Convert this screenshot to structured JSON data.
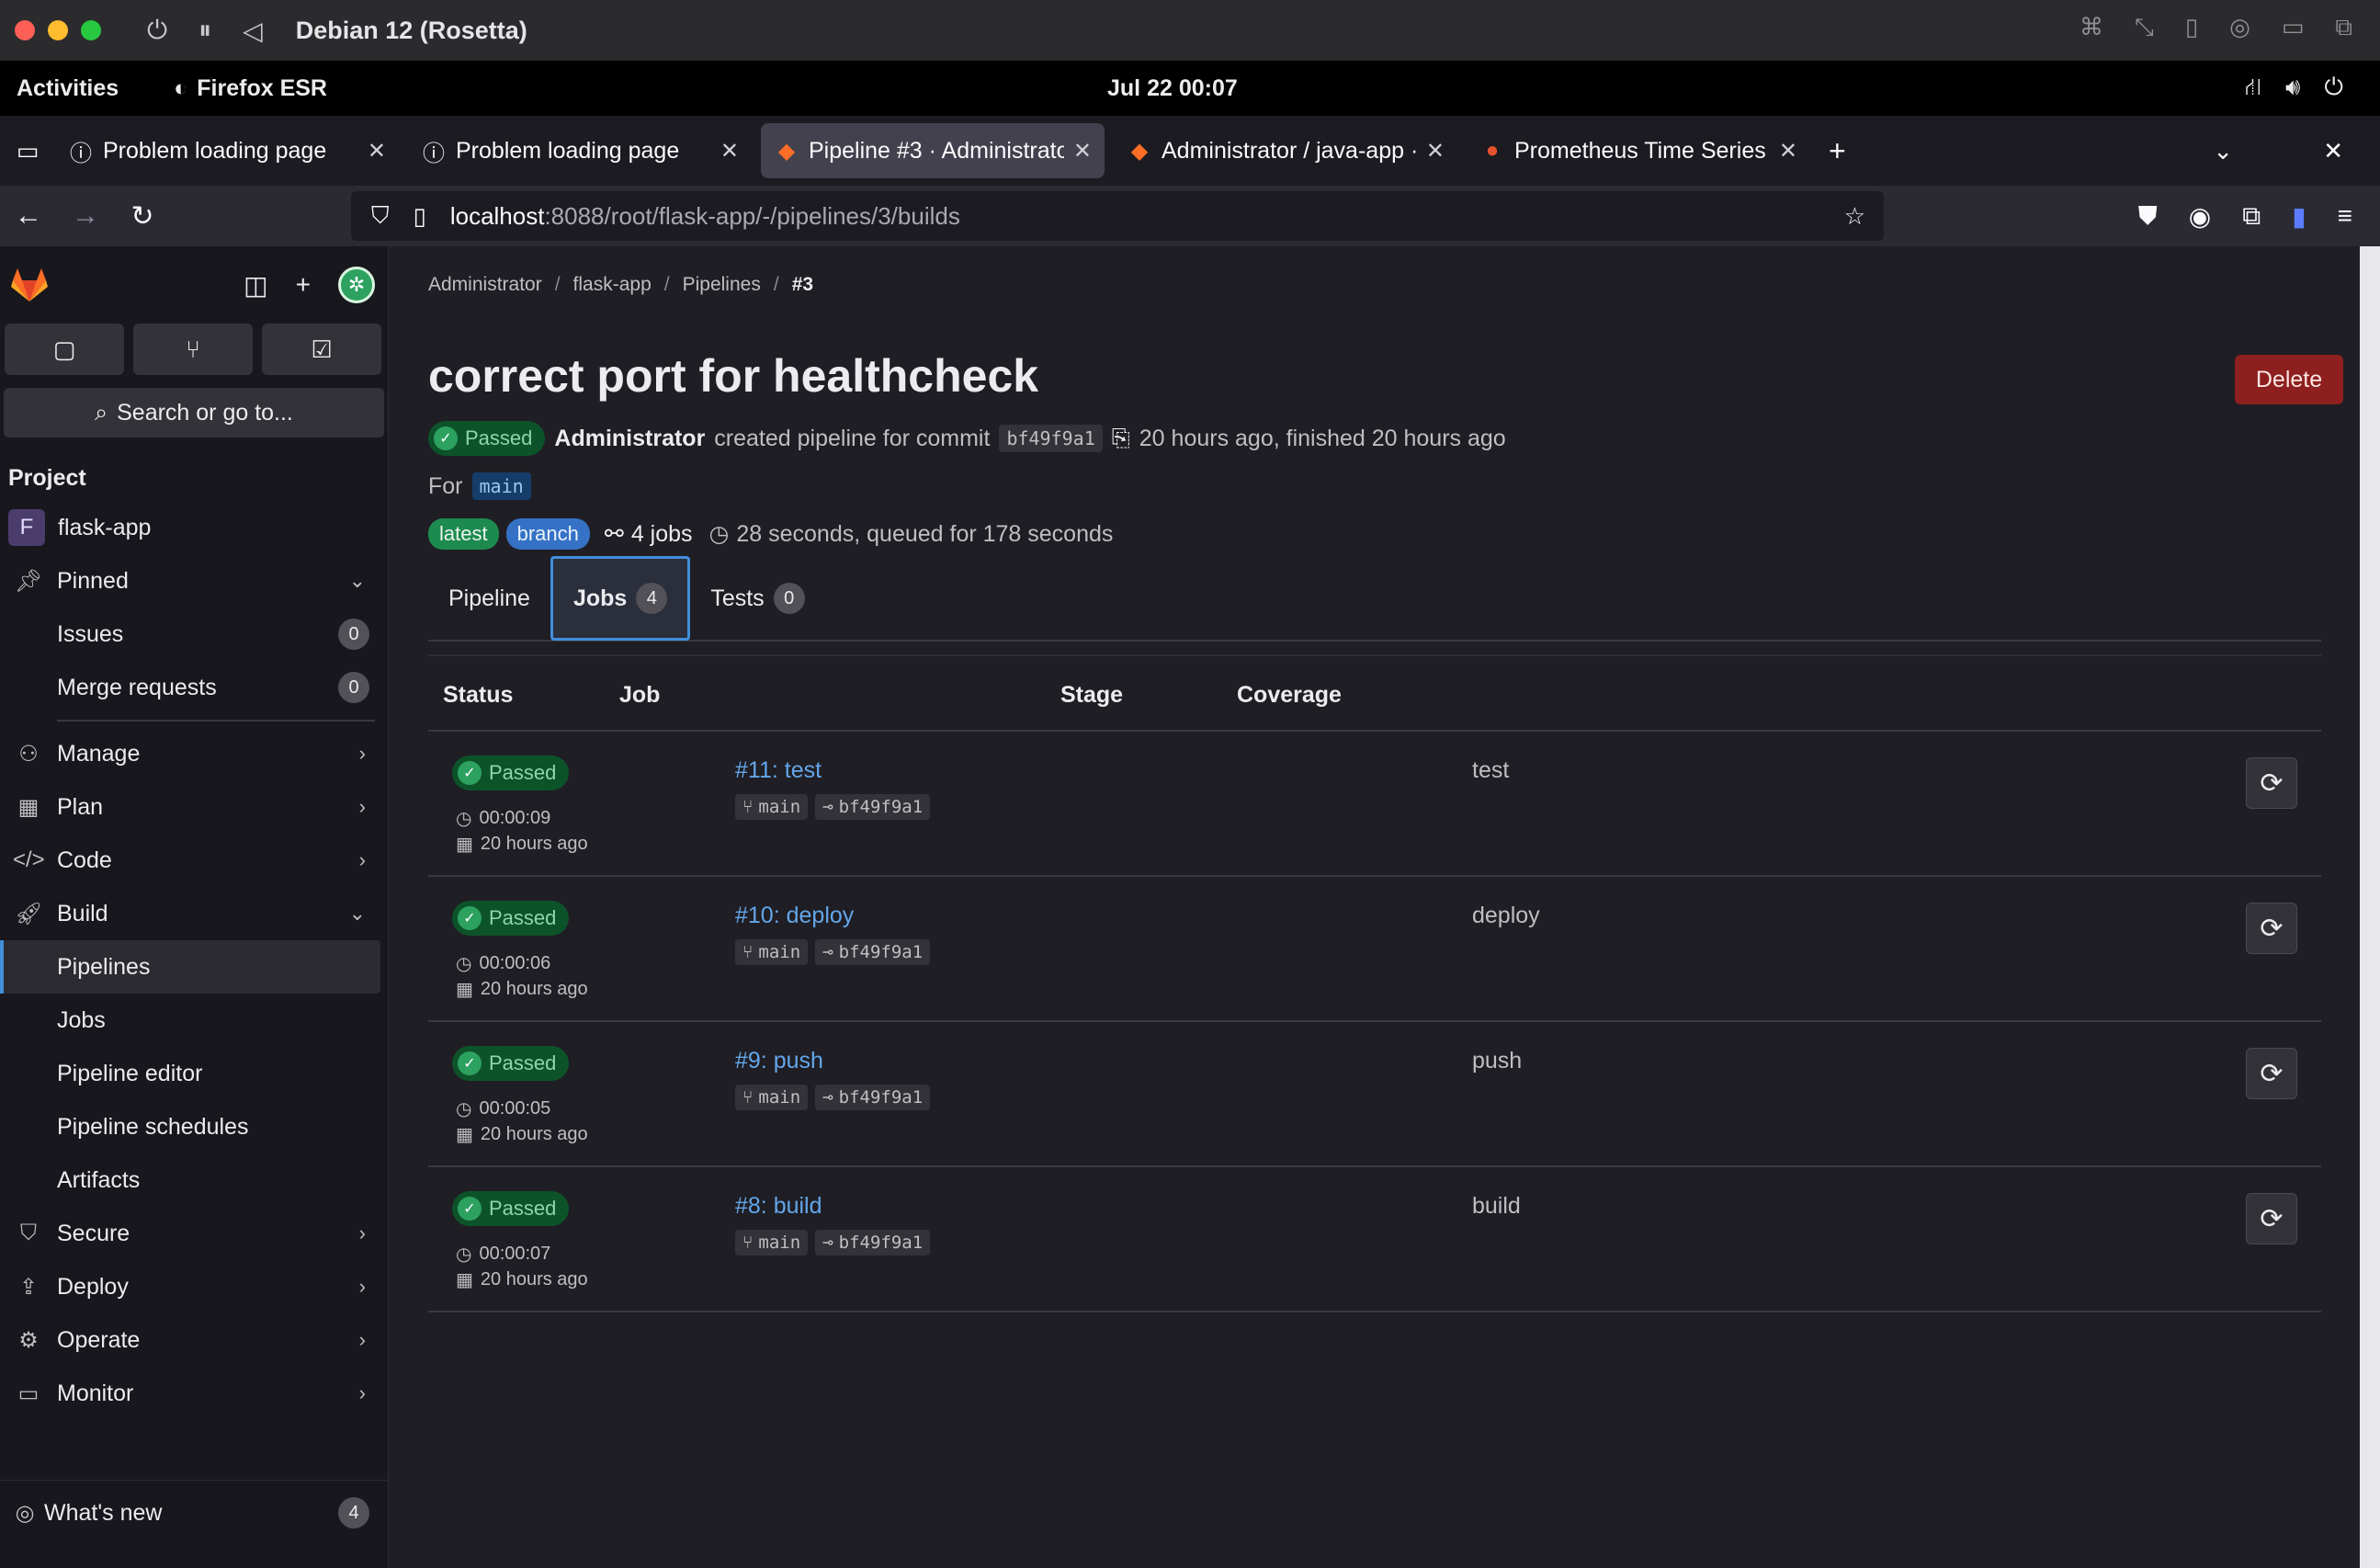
{
  "window": {
    "title": "Debian 12 (Rosetta)",
    "traffic_colors": [
      "#fe5f57",
      "#febc2e",
      "#28c840"
    ]
  },
  "gnome": {
    "activities": "Activities",
    "app": "Firefox ESR",
    "clock": "Jul 22  00:07"
  },
  "tabs": [
    {
      "label": "Problem loading page",
      "icon": "info-circle-icon",
      "active": false
    },
    {
      "label": "Problem loading page",
      "icon": "info-circle-icon",
      "active": false
    },
    {
      "label": "Pipeline #3 · Administrato",
      "icon": "gitlab-icon",
      "active": true
    },
    {
      "label": "Administrator / java-app ·",
      "icon": "gitlab-icon",
      "active": false
    },
    {
      "label": "Prometheus Time Series C",
      "icon": "prometheus-icon",
      "active": false
    }
  ],
  "url": {
    "host": "localhost",
    "path": ":8088/root/flask-app/-/pipelines/3/builds"
  },
  "sidebar": {
    "search": "Search or go to...",
    "section": "Project",
    "project_letter": "F",
    "project_name": "flask-app",
    "items": [
      {
        "label": "Pinned",
        "icon": "pin-icon",
        "chev": "⌄"
      },
      {
        "label": "Issues",
        "count": "0"
      },
      {
        "label": "Merge requests",
        "count": "0"
      },
      {
        "label": "Manage",
        "icon": "users-icon",
        "chev": "›"
      },
      {
        "label": "Plan",
        "icon": "calendar-icon",
        "chev": "›"
      },
      {
        "label": "Code",
        "icon": "code-icon",
        "chev": "›"
      },
      {
        "label": "Build",
        "icon": "rocket-icon",
        "chev": "⌄"
      },
      {
        "label": "Pipelines"
      },
      {
        "label": "Jobs"
      },
      {
        "label": "Pipeline editor"
      },
      {
        "label": "Pipeline schedules"
      },
      {
        "label": "Artifacts"
      },
      {
        "label": "Secure",
        "icon": "shield-icon",
        "chev": "›"
      },
      {
        "label": "Deploy",
        "icon": "deploy-icon",
        "chev": "›"
      },
      {
        "label": "Operate",
        "icon": "operate-icon",
        "chev": "›"
      },
      {
        "label": "Monitor",
        "icon": "monitor-icon",
        "chev": "›"
      }
    ],
    "whats_new": "What's new",
    "whats_new_count": "4"
  },
  "breadcrumb": [
    "Administrator",
    "flask-app",
    "Pipelines",
    "#3"
  ],
  "pipeline": {
    "title": "correct port for healthcheck",
    "delete_label": "Delete",
    "status": "Passed",
    "author": "Administrator",
    "created_text": "created pipeline for commit",
    "sha": "bf49f9a1",
    "time_text": "20 hours ago, finished 20 hours ago",
    "for_label": "For",
    "branch": "main",
    "tag_latest": "latest",
    "tag_branch": "branch",
    "jobs_count_text": "4 jobs",
    "duration_text": "28 seconds, queued for 178 seconds"
  },
  "page_tabs": [
    {
      "label": "Pipeline"
    },
    {
      "label": "Jobs",
      "count": "4",
      "active": true
    },
    {
      "label": "Tests",
      "count": "0"
    }
  ],
  "jobs_table": {
    "headers": [
      "Status",
      "Job",
      "Stage",
      "Coverage"
    ],
    "rows": [
      {
        "status": "Passed",
        "duration": "00:00:09",
        "finished": "20 hours ago",
        "job": "#11: test",
        "ref": "main",
        "sha": "bf49f9a1",
        "stage": "test"
      },
      {
        "status": "Passed",
        "duration": "00:00:06",
        "finished": "20 hours ago",
        "job": "#10: deploy",
        "ref": "main",
        "sha": "bf49f9a1",
        "stage": "deploy"
      },
      {
        "status": "Passed",
        "duration": "00:00:05",
        "finished": "20 hours ago",
        "job": "#9: push",
        "ref": "main",
        "sha": "bf49f9a1",
        "stage": "push"
      },
      {
        "status": "Passed",
        "duration": "00:00:07",
        "finished": "20 hours ago",
        "job": "#8: build",
        "ref": "main",
        "sha": "bf49f9a1",
        "stage": "build"
      }
    ]
  }
}
